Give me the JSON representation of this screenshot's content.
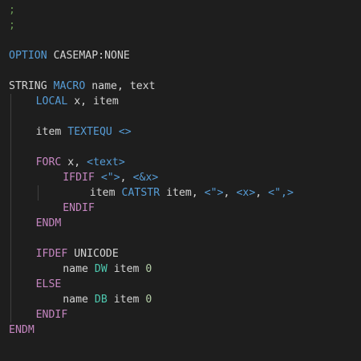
{
  "theme": {
    "background": "#1e1e1e",
    "indent_guide": "#404040",
    "colors": {
      "comment": "#6a9955",
      "keyword": "#569cd6",
      "plain": "#d4d4d4",
      "control": "#c586c0",
      "type": "#4ec9b0",
      "number": "#b5cea8"
    }
  },
  "code": {
    "lines": [
      {
        "indent": 0,
        "tokens": [
          {
            "t": ";",
            "c": "comment"
          }
        ]
      },
      {
        "indent": 0,
        "tokens": [
          {
            "t": ";",
            "c": "comment"
          }
        ]
      },
      {
        "indent": 0,
        "tokens": []
      },
      {
        "indent": 0,
        "tokens": [
          {
            "t": "OPTION",
            "c": "keyword"
          },
          {
            "t": " CASEMAP:NONE",
            "c": "plain"
          }
        ]
      },
      {
        "indent": 0,
        "tokens": []
      },
      {
        "indent": 0,
        "tokens": [
          {
            "t": "STRING ",
            "c": "plain"
          },
          {
            "t": "MACRO",
            "c": "keyword"
          },
          {
            "t": " name, text",
            "c": "plain"
          }
        ]
      },
      {
        "indent": 4,
        "tokens": [
          {
            "t": "LOCAL",
            "c": "keyword"
          },
          {
            "t": " x, item",
            "c": "plain"
          }
        ]
      },
      {
        "indent": 0,
        "tokens": []
      },
      {
        "indent": 4,
        "tokens": [
          {
            "t": "item ",
            "c": "plain"
          },
          {
            "t": "TEXTEQU <>",
            "c": "keyword"
          }
        ]
      },
      {
        "indent": 0,
        "tokens": []
      },
      {
        "indent": 4,
        "tokens": [
          {
            "t": "FORC",
            "c": "control"
          },
          {
            "t": " x, ",
            "c": "plain"
          },
          {
            "t": "<text>",
            "c": "keyword"
          }
        ]
      },
      {
        "indent": 8,
        "tokens": [
          {
            "t": "IFDIF",
            "c": "control"
          },
          {
            "t": " ",
            "c": "plain"
          },
          {
            "t": "<\">",
            "c": "keyword"
          },
          {
            "t": ", ",
            "c": "plain"
          },
          {
            "t": "<&x>",
            "c": "keyword"
          }
        ]
      },
      {
        "indent": 12,
        "tokens": [
          {
            "t": "item ",
            "c": "plain"
          },
          {
            "t": "CATSTR",
            "c": "keyword"
          },
          {
            "t": " item, ",
            "c": "plain"
          },
          {
            "t": "<\">",
            "c": "keyword"
          },
          {
            "t": ", ",
            "c": "plain"
          },
          {
            "t": "<x>",
            "c": "keyword"
          },
          {
            "t": ", ",
            "c": "plain"
          },
          {
            "t": "<\",>",
            "c": "keyword"
          }
        ]
      },
      {
        "indent": 8,
        "tokens": [
          {
            "t": "ENDIF",
            "c": "control"
          }
        ]
      },
      {
        "indent": 4,
        "tokens": [
          {
            "t": "ENDM",
            "c": "control"
          }
        ]
      },
      {
        "indent": 0,
        "tokens": []
      },
      {
        "indent": 4,
        "tokens": [
          {
            "t": "IFDEF",
            "c": "control"
          },
          {
            "t": " UNICODE",
            "c": "plain"
          }
        ]
      },
      {
        "indent": 8,
        "tokens": [
          {
            "t": "name ",
            "c": "plain"
          },
          {
            "t": "DW",
            "c": "type"
          },
          {
            "t": " item ",
            "c": "plain"
          },
          {
            "t": "0",
            "c": "number"
          }
        ]
      },
      {
        "indent": 4,
        "tokens": [
          {
            "t": "ELSE",
            "c": "control"
          }
        ]
      },
      {
        "indent": 8,
        "tokens": [
          {
            "t": "name ",
            "c": "plain"
          },
          {
            "t": "DB",
            "c": "type"
          },
          {
            "t": " item ",
            "c": "plain"
          },
          {
            "t": "0",
            "c": "number"
          }
        ]
      },
      {
        "indent": 4,
        "tokens": [
          {
            "t": "ENDIF",
            "c": "control"
          }
        ]
      },
      {
        "indent": 0,
        "tokens": [
          {
            "t": "ENDM",
            "c": "control"
          }
        ]
      }
    ]
  }
}
